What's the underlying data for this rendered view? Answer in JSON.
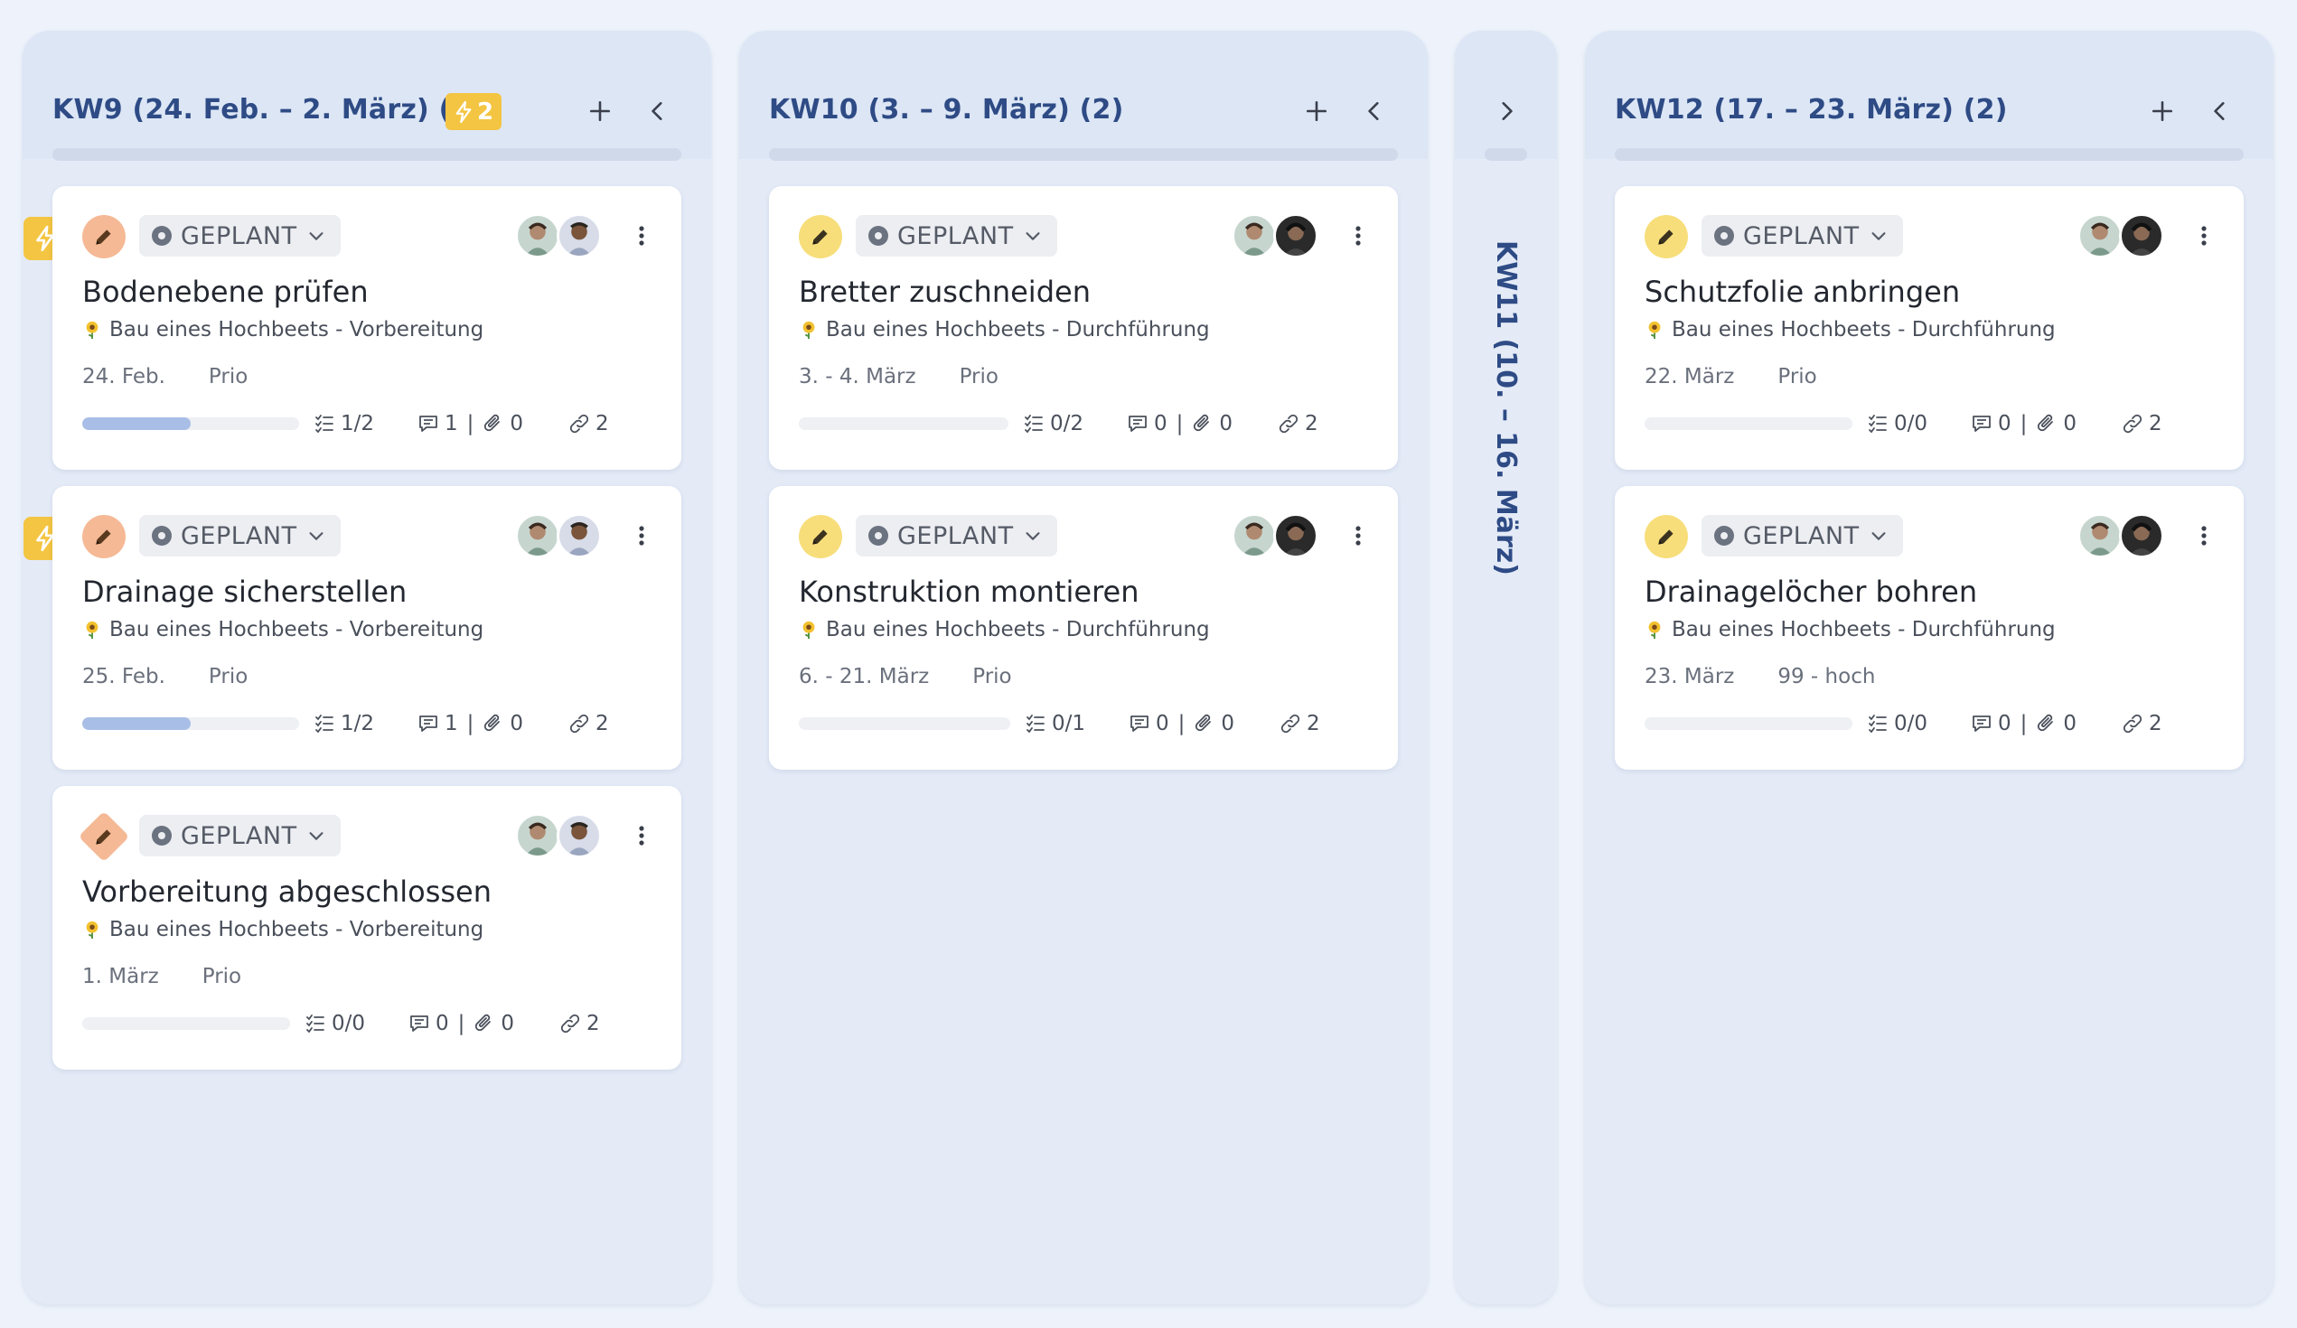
{
  "colors": {
    "accent": "#2e4b85",
    "bolt": "#f4c542",
    "pen_orange": "#f5b995",
    "pen_yellow": "#f7de7a",
    "progress": "#a8bee6"
  },
  "columns": [
    {
      "title": "KW9 (24. Feb. – 2. März)  (3)",
      "badge_count": "2",
      "cards": [
        {
          "status": "GEPLANT",
          "title": "Bodenebene prüfen",
          "project": "Bau eines Hochbeets - Vorbereitung",
          "date": "24. Feb.",
          "prio": "Prio",
          "checklist": "1/2",
          "comments": "1",
          "attachments": "0",
          "links": "2",
          "progress": 0.5
        },
        {
          "status": "GEPLANT",
          "title": "Drainage sicherstellen",
          "project": "Bau eines Hochbeets - Vorbereitung",
          "date": "25. Feb.",
          "prio": "Prio",
          "checklist": "1/2",
          "comments": "1",
          "attachments": "0",
          "links": "2",
          "progress": 0.5
        },
        {
          "status": "GEPLANT",
          "title": "Vorbereitung abgeschlossen",
          "project": "Bau eines Hochbeets - Vorbereitung",
          "date": "1. März",
          "prio": "Prio",
          "checklist": "0/0",
          "comments": "0",
          "attachments": "0",
          "links": "2",
          "progress": 0
        }
      ]
    },
    {
      "title": "KW10 (3. – 9. März)  (2)",
      "cards": [
        {
          "status": "GEPLANT",
          "title": "Bretter zuschneiden",
          "project": "Bau eines Hochbeets - Durchführung",
          "date": "3. - 4. März",
          "prio": "Prio",
          "checklist": "0/2",
          "comments": "0",
          "attachments": "0",
          "links": "2",
          "progress": 0
        },
        {
          "status": "GEPLANT",
          "title": "Konstruktion montieren",
          "project": "Bau eines Hochbeets - Durchführung",
          "date": "6. - 21. März",
          "prio": "Prio",
          "checklist": "0/1",
          "comments": "0",
          "attachments": "0",
          "links": "2",
          "progress": 0
        }
      ]
    },
    {
      "title": "KW11 (10. – 16. März)"
    },
    {
      "title": "KW12 (17. – 23. März)  (2)",
      "cards": [
        {
          "status": "GEPLANT",
          "title": "Schutzfolie anbringen",
          "project": "Bau eines Hochbeets - Durchführung",
          "date": "22. März",
          "prio": "Prio",
          "checklist": "0/0",
          "comments": "0",
          "attachments": "0",
          "links": "2",
          "progress": 0
        },
        {
          "status": "GEPLANT",
          "title": "Drainagelöcher bohren",
          "project": "Bau eines Hochbeets - Durchführung",
          "date": "23. März",
          "prio": "99 - hoch",
          "checklist": "0/0",
          "comments": "0",
          "attachments": "0",
          "links": "2",
          "progress": 0
        }
      ]
    }
  ],
  "icons": {
    "pen": "pencil-icon",
    "bolt": "lightning-icon",
    "add": "plus-icon",
    "collapse": "chevron-left-icon",
    "expand": "chevron-right-icon",
    "more": "more-vertical-icon",
    "checklist": "checklist-icon",
    "comment": "comment-icon",
    "attachment": "paperclip-icon",
    "link": "link-icon",
    "project": "sunflower-icon"
  }
}
